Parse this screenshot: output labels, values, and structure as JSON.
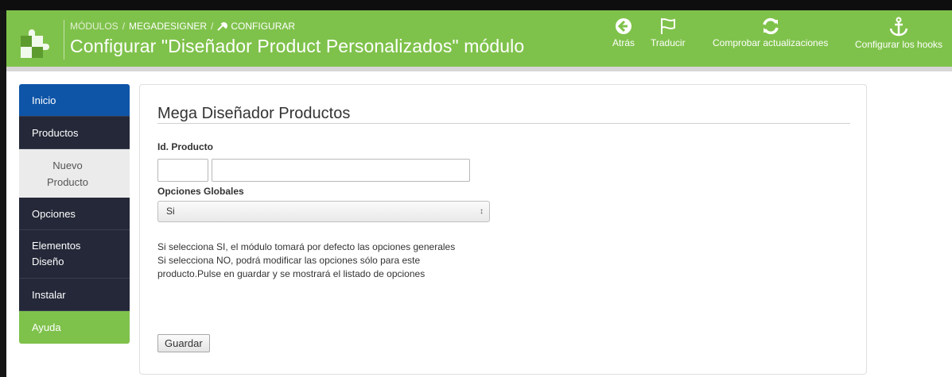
{
  "header": {
    "breadcrumb": [
      "MÓDULOS",
      "MEGADESIGNER",
      "CONFIGURAR"
    ],
    "breadcrumb_separator": "/",
    "title": "Configurar \"Diseñador Product Personalizados\" módulo",
    "buttons": [
      {
        "label": "Atrás",
        "icon": "back-circle-icon"
      },
      {
        "label": "Traducir",
        "icon": "flag-icon"
      },
      {
        "label": "Comprobar actualizaciones",
        "icon": "refresh-icon"
      },
      {
        "label": "Configurar los hooks",
        "icon": "anchor-icon"
      }
    ],
    "accent_color": "#7fc24b"
  },
  "sidebar": {
    "items": [
      {
        "label": "Inicio"
      },
      {
        "label": "Productos"
      },
      {
        "label": "Nuevo Producto"
      },
      {
        "label": "Opciones"
      },
      {
        "label": "Elementos Diseño"
      },
      {
        "label": "Instalar"
      },
      {
        "label": "Ayuda"
      }
    ]
  },
  "panel": {
    "title": "Mega Diseñador Productos",
    "id_label": "Id. Producto",
    "id_value_1": "",
    "id_value_2": "",
    "global_label": "Opciones Globales",
    "global_selected": "Si",
    "help_lines": [
      "Si selecciona SI, el módulo tomará por defecto las opciones generales",
      "Si selecciona NO, podrá modificar las opciones sólo para este producto.Pulse en guardar y se mostrará el listado de opciones"
    ],
    "save_label": "Guardar"
  }
}
